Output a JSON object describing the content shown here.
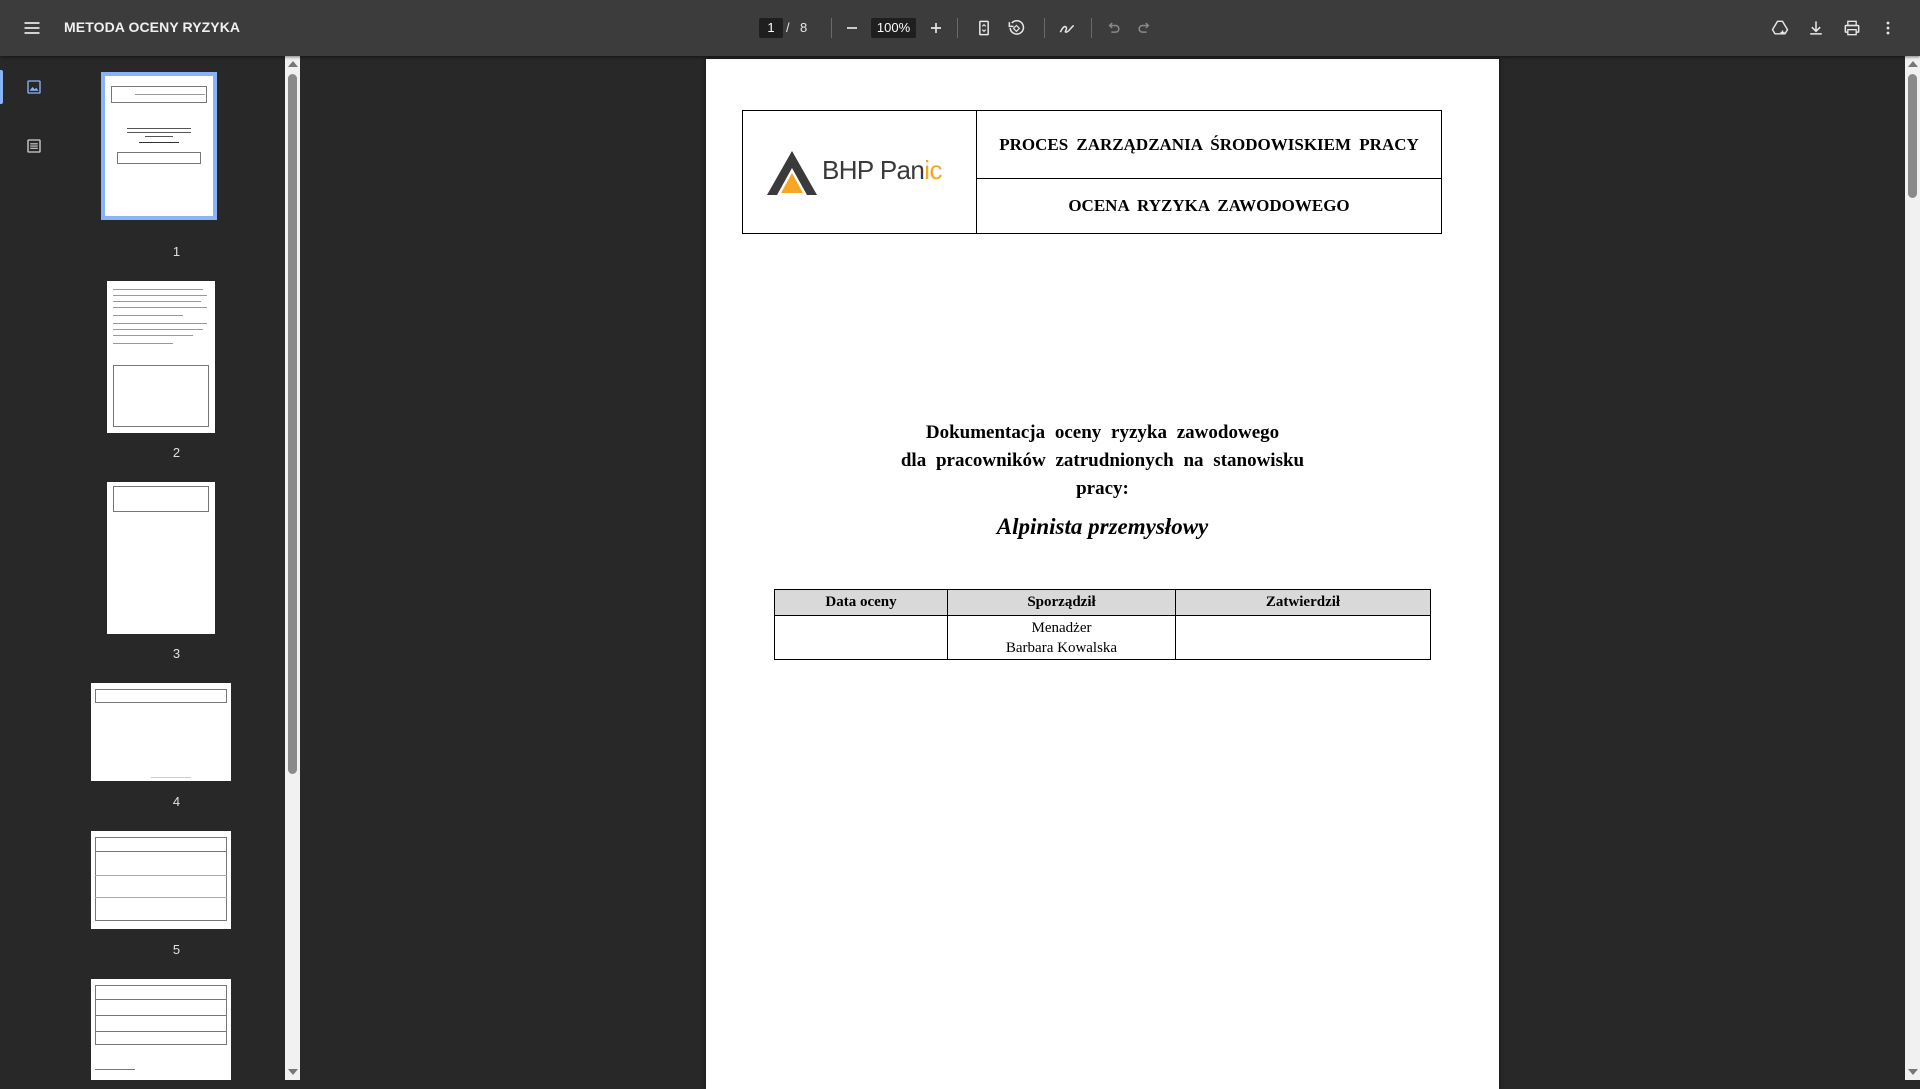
{
  "toolbar": {
    "menu_icon": "menu-icon",
    "title": "METODA OCENY RYZYKA",
    "current_page": "1",
    "page_separator": "/",
    "total_pages": "8",
    "zoom": "100%",
    "icons": [
      "minus-icon",
      "plus-icon",
      "fit-page-icon",
      "rotate-icon",
      "annotate-icon",
      "undo-icon",
      "redo-icon",
      "drive-save-icon",
      "download-icon",
      "print-icon",
      "more-vert-icon"
    ]
  },
  "sidebar": {
    "tabs": [
      "thumbnails-icon",
      "outline-icon"
    ],
    "thumbnails": [
      {
        "label": "1"
      },
      {
        "label": "2"
      },
      {
        "label": "3"
      },
      {
        "label": "4"
      },
      {
        "label": "5"
      }
    ]
  },
  "document": {
    "header": {
      "logo_text": "BHP Pan",
      "logo_suffix": "ic",
      "row1": "PROCES ZARZĄDZANIA ŚRODOWISKIEM PRACY",
      "row2": "OCENA RYZYKA ZAWODOWEGO"
    },
    "title_line1": "Dokumentacja oceny ryzyka zawodowego",
    "title_line2": "dla pracowników zatrudnionych na stanowisku",
    "title_line3": "pracy:",
    "position": "Alpinista przemysłowy",
    "table": {
      "headers": [
        "Data oceny",
        "Sporządził",
        "Zatwierdził"
      ],
      "row": [
        "",
        "Menadżer",
        "Barbara Kowalska",
        ""
      ]
    }
  },
  "colors": {
    "toolbar_bg": "#3c3c3c",
    "viewer_bg": "#282828",
    "accent": "#8ab4f8",
    "logo_orange": "#f5a623"
  }
}
